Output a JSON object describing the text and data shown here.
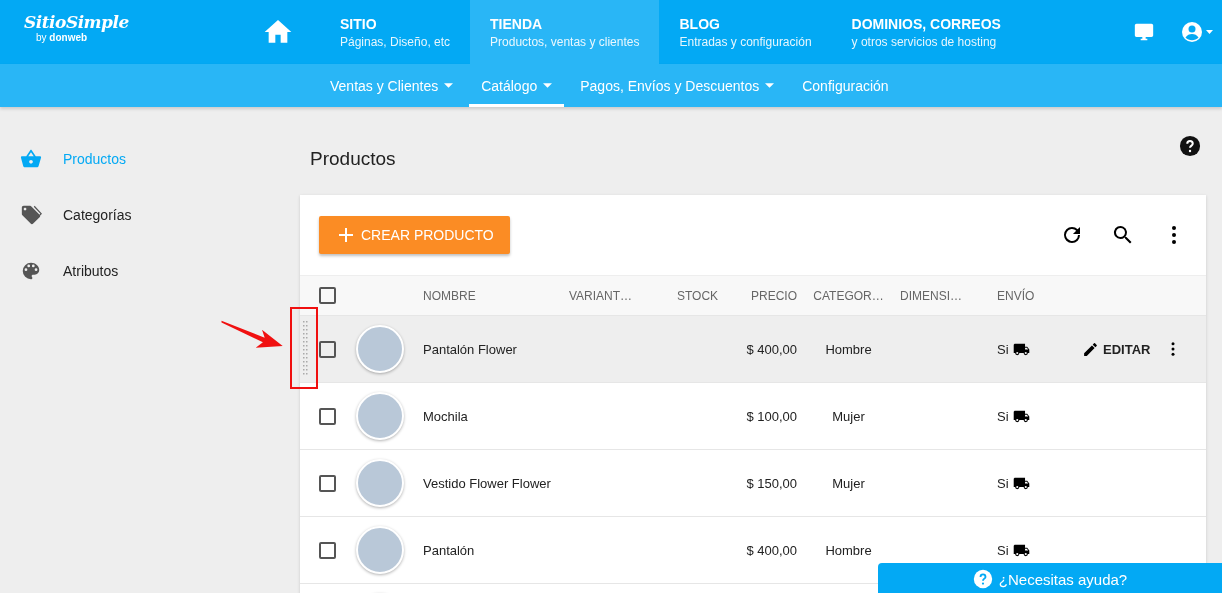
{
  "logo": {
    "name": "SitioSimple",
    "tagline_prefix": "by",
    "tagline_brand": "donweb"
  },
  "top_nav": [
    {
      "title": "SITIO",
      "subtitle": "Páginas, Diseño, etc",
      "selected": false
    },
    {
      "title": "TIENDA",
      "subtitle": "Productos, ventas y clientes",
      "selected": true
    },
    {
      "title": "BLOG",
      "subtitle": "Entradas y configuración",
      "selected": false
    },
    {
      "title": "DOMINIOS, CORREOS",
      "subtitle": "y otros servicios de hosting",
      "selected": false
    }
  ],
  "sub_nav": [
    {
      "label": "Ventas y Clientes",
      "dropdown": true,
      "selected": false
    },
    {
      "label": "Catálogo",
      "dropdown": true,
      "selected": true
    },
    {
      "label": "Pagos, Envíos y Descuentos",
      "dropdown": true,
      "selected": false
    },
    {
      "label": "Configuración",
      "dropdown": false,
      "selected": false
    }
  ],
  "sidebar": {
    "items": [
      {
        "label": "Productos",
        "kind": "basket",
        "selected": true
      },
      {
        "label": "Categorías",
        "kind": "tag",
        "selected": false
      },
      {
        "label": "Atributos",
        "kind": "palette",
        "selected": false
      }
    ]
  },
  "page_title": "Productos",
  "create_button": "CREAR PRODUCTO",
  "table": {
    "header_checked": false,
    "columns": [
      "NOMBRE",
      "VARIANT…",
      "STOCK",
      "PRECIO",
      "CATEGOR…",
      "DIMENSI…",
      "ENVÍO"
    ],
    "rows": [
      {
        "name": "Pantalón Flower",
        "price": "$ 400,00",
        "category": "Hombre",
        "shipping": "Si",
        "checked": false,
        "hovered": true
      },
      {
        "name": "Mochila",
        "price": "$ 100,00",
        "category": "Mujer",
        "shipping": "Si",
        "checked": false,
        "hovered": false
      },
      {
        "name": "Vestido Flower Flower",
        "price": "$ 150,00",
        "category": "Mujer",
        "shipping": "Si",
        "checked": false,
        "hovered": false
      },
      {
        "name": "Pantalón",
        "price": "$ 400,00",
        "category": "Hombre",
        "shipping": "Si",
        "checked": false,
        "hovered": false
      }
    ],
    "edit_label": "EDITAR"
  },
  "help_button": "¿Necesitas ayuda?"
}
